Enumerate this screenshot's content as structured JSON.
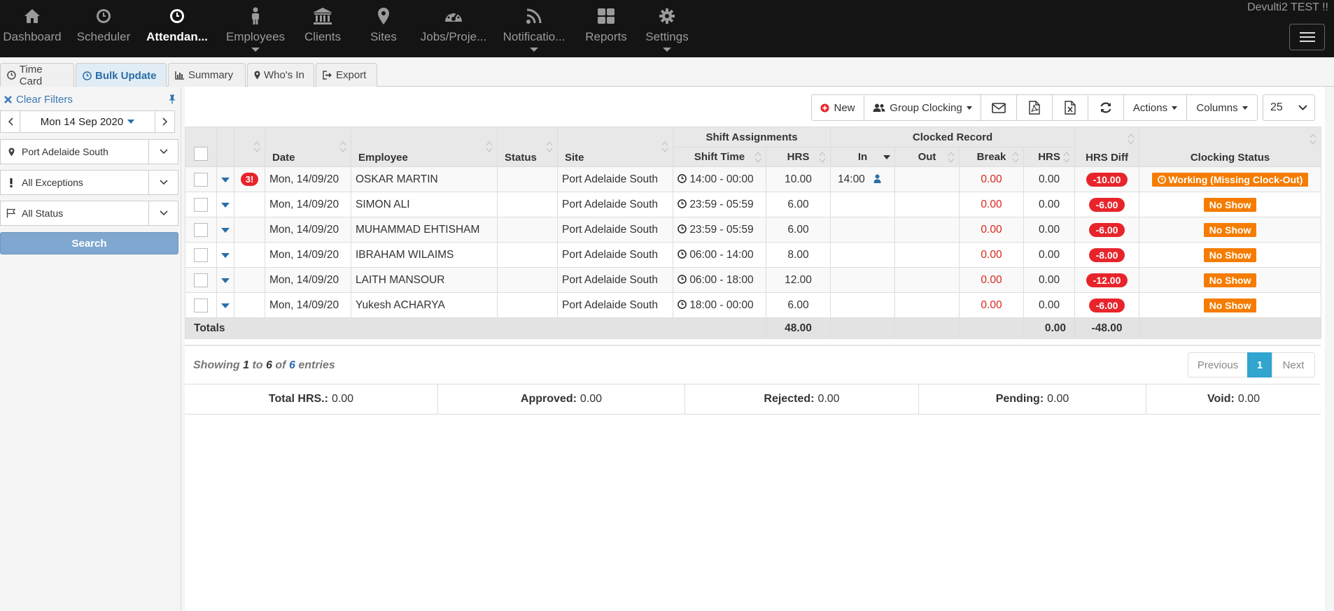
{
  "nav": {
    "items": [
      {
        "label": "Dashboard",
        "icon": "home-icon"
      },
      {
        "label": "Scheduler",
        "icon": "clock-icon"
      },
      {
        "label": "Attendan...",
        "icon": "clock-icon"
      },
      {
        "label": "Employees",
        "icon": "person-icon"
      },
      {
        "label": "Clients",
        "icon": "bank-icon"
      },
      {
        "label": "Sites",
        "icon": "map-marker-icon"
      },
      {
        "label": "Jobs/Proje...",
        "icon": "dashboard-icon"
      },
      {
        "label": "Notificatio...",
        "icon": "rss-icon"
      },
      {
        "label": "Reports",
        "icon": "grid-icon"
      },
      {
        "label": "Settings",
        "icon": "gear-icon"
      }
    ],
    "brand": "Devulti2 TEST !!"
  },
  "tabs": [
    {
      "label": "Time Card",
      "icon": "clock-icon"
    },
    {
      "label": "Bulk Update",
      "icon": "clock-icon"
    },
    {
      "label": "Summary",
      "icon": "bar-chart-icon"
    },
    {
      "label": "Who's In",
      "icon": "map-marker-icon"
    },
    {
      "label": "Export",
      "icon": "sign-out-icon"
    }
  ],
  "sidebar": {
    "clear_filters": "Clear Filters",
    "date": "Mon 14 Sep 2020",
    "site_filter": "Port Adelaide South",
    "exceptions_filter": "All Exceptions",
    "status_filter": "All Status",
    "search": "Search"
  },
  "toolbar": {
    "new": "New",
    "group_clocking": "Group Clocking",
    "actions": "Actions",
    "columns": "Columns",
    "page_size": "25"
  },
  "table": {
    "group_headers": {
      "shift": "Shift Assignments",
      "clocked": "Clocked Record"
    },
    "headers": {
      "date": "Date",
      "employee": "Employee",
      "status": "Status",
      "site": "Site",
      "shift_time": "Shift Time",
      "shift_hrs": "HRS",
      "in": "In",
      "out": "Out",
      "break": "Break",
      "clocked_hrs": "HRS",
      "hrs_diff": "HRS Diff",
      "clocking_status": "Clocking Status"
    },
    "rows": [
      {
        "badge": "3!",
        "date": "Mon, 14/09/20",
        "employee": "OSKAR MARTIN",
        "site": "Port Adelaide South",
        "shift_time": "14:00 - 00:00",
        "shift_hrs": "10.00",
        "in": "14:00",
        "break": "0.00",
        "hrs": "0.00",
        "diff": "-10.00",
        "clocking_status": "Working (Missing Clock-Out)"
      },
      {
        "badge": "",
        "date": "Mon, 14/09/20",
        "employee": "SIMON ALI",
        "site": "Port Adelaide South",
        "shift_time": "23:59 - 05:59",
        "shift_hrs": "6.00",
        "in": "",
        "break": "0.00",
        "hrs": "0.00",
        "diff": "-6.00",
        "clocking_status": "No Show"
      },
      {
        "badge": "",
        "date": "Mon, 14/09/20",
        "employee": "MUHAMMAD EHTISHAM",
        "site": "Port Adelaide South",
        "shift_time": "23:59 - 05:59",
        "shift_hrs": "6.00",
        "in": "",
        "break": "0.00",
        "hrs": "0.00",
        "diff": "-6.00",
        "clocking_status": "No Show"
      },
      {
        "badge": "",
        "date": "Mon, 14/09/20",
        "employee": "IBRAHAM WILAIMS",
        "site": "Port Adelaide South",
        "shift_time": "06:00 - 14:00",
        "shift_hrs": "8.00",
        "in": "",
        "break": "0.00",
        "hrs": "0.00",
        "diff": "-8.00",
        "clocking_status": "No Show"
      },
      {
        "badge": "",
        "date": "Mon, 14/09/20",
        "employee": "LAITH MANSOUR",
        "site": "Port Adelaide South",
        "shift_time": "06:00 - 18:00",
        "shift_hrs": "12.00",
        "in": "",
        "break": "0.00",
        "hrs": "0.00",
        "diff": "-12.00",
        "clocking_status": "No Show"
      },
      {
        "badge": "",
        "date": "Mon, 14/09/20",
        "employee": "Yukesh ACHARYA",
        "site": "Port Adelaide South",
        "shift_time": "18:00 - 00:00",
        "shift_hrs": "6.00",
        "in": "",
        "break": "0.00",
        "hrs": "0.00",
        "diff": "-6.00",
        "clocking_status": "No Show"
      }
    ],
    "totals": {
      "label": "Totals",
      "shift_hrs": "48.00",
      "hrs": "0.00",
      "diff": "-48.00"
    }
  },
  "pagination": {
    "showing_prefix": "Showing",
    "from": "1",
    "to_word": "to",
    "to": "6",
    "of_word": "of",
    "total": "6",
    "suffix": "entries",
    "previous": "Previous",
    "page": "1",
    "next": "Next"
  },
  "summary": {
    "total_label": "Total HRS.:",
    "total": "0.00",
    "approved_label": "Approved:",
    "approved": "0.00",
    "rejected_label": "Rejected:",
    "rejected": "0.00",
    "pending_label": "Pending:",
    "pending": "0.00",
    "void_label": "Void:",
    "void": "0.00"
  }
}
